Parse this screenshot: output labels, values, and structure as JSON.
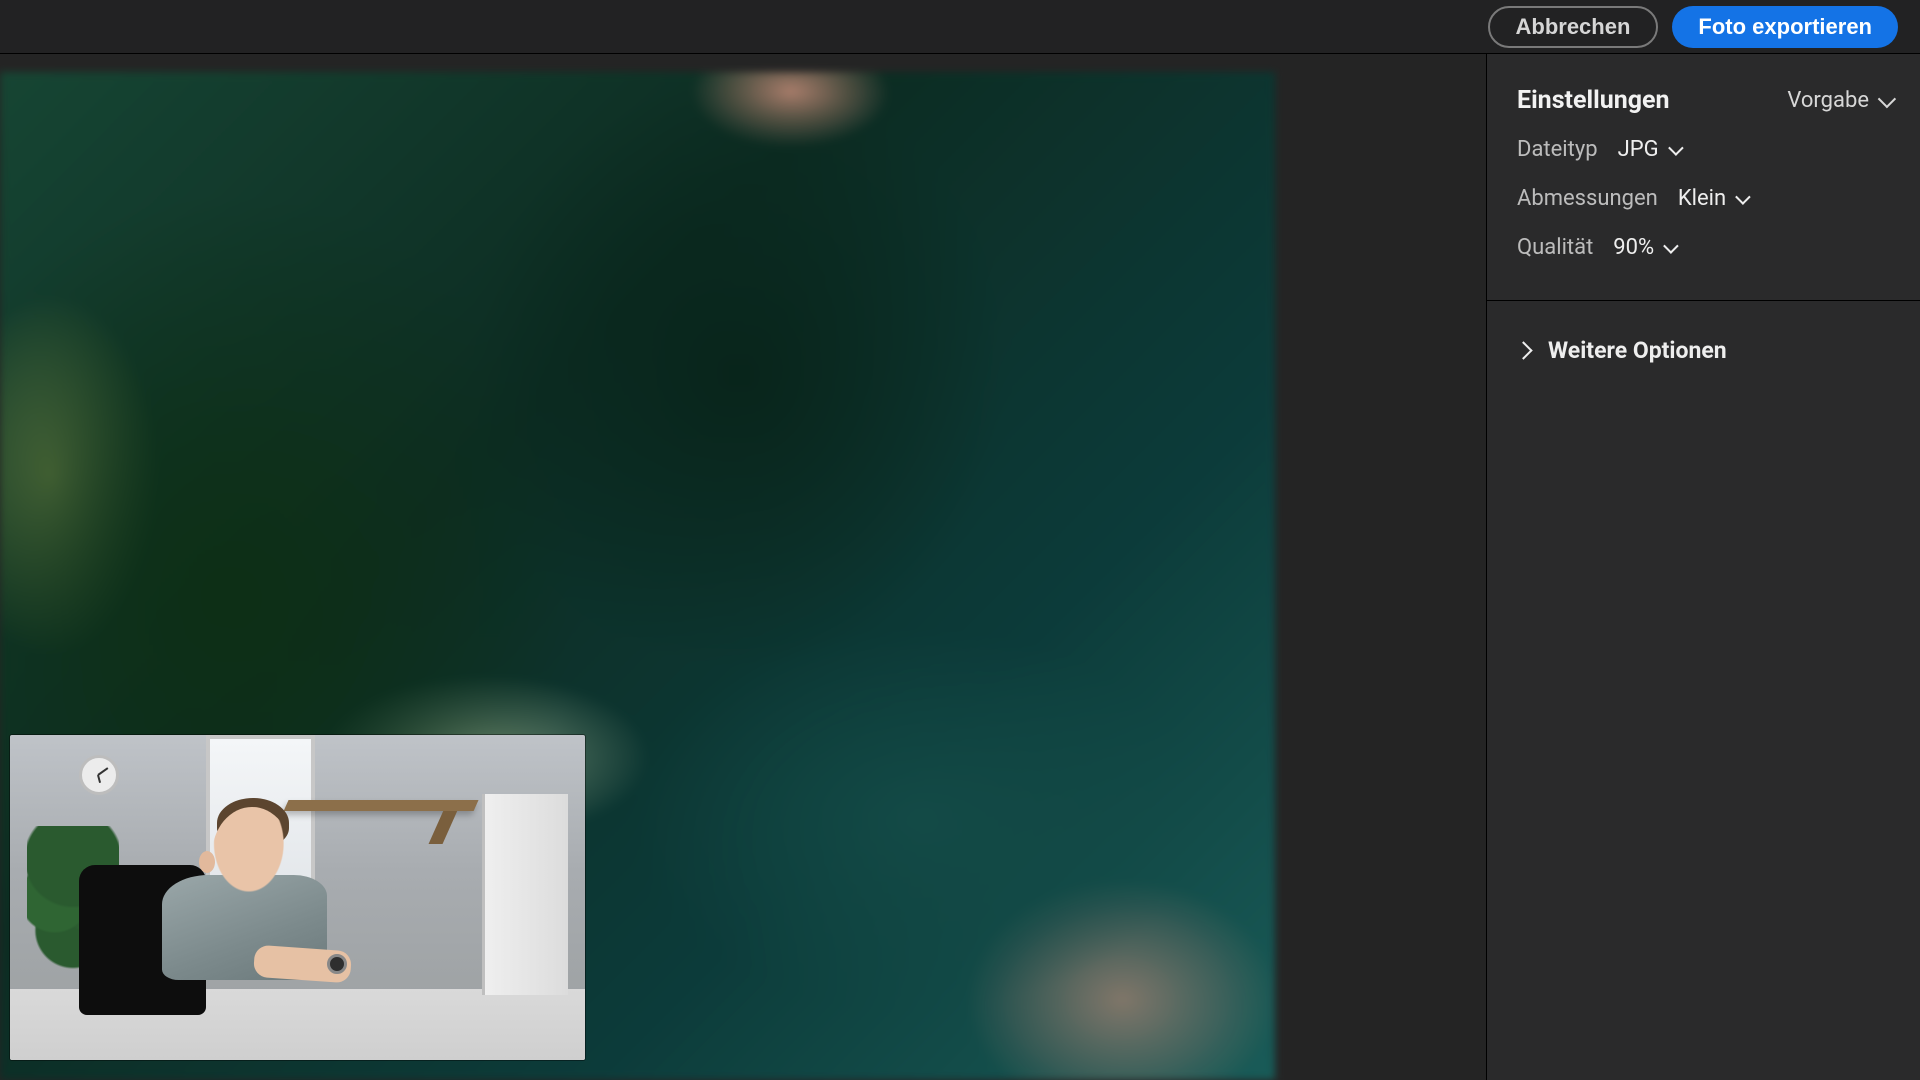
{
  "topbar": {
    "cancel_label": "Abbrechen",
    "export_label": "Foto exportieren"
  },
  "panel": {
    "title": "Einstellungen",
    "preset_label": "Vorgabe",
    "filetype": {
      "label": "Dateityp",
      "value": "JPG"
    },
    "dimensions": {
      "label": "Abmessungen",
      "value": "Klein"
    },
    "quality": {
      "label": "Qualität",
      "value": "90%"
    },
    "more_options_label": "Weitere Optionen"
  },
  "colors": {
    "accent": "#1473e6",
    "panel_bg": "#2a2a2b",
    "canvas_bg": "#242424"
  }
}
